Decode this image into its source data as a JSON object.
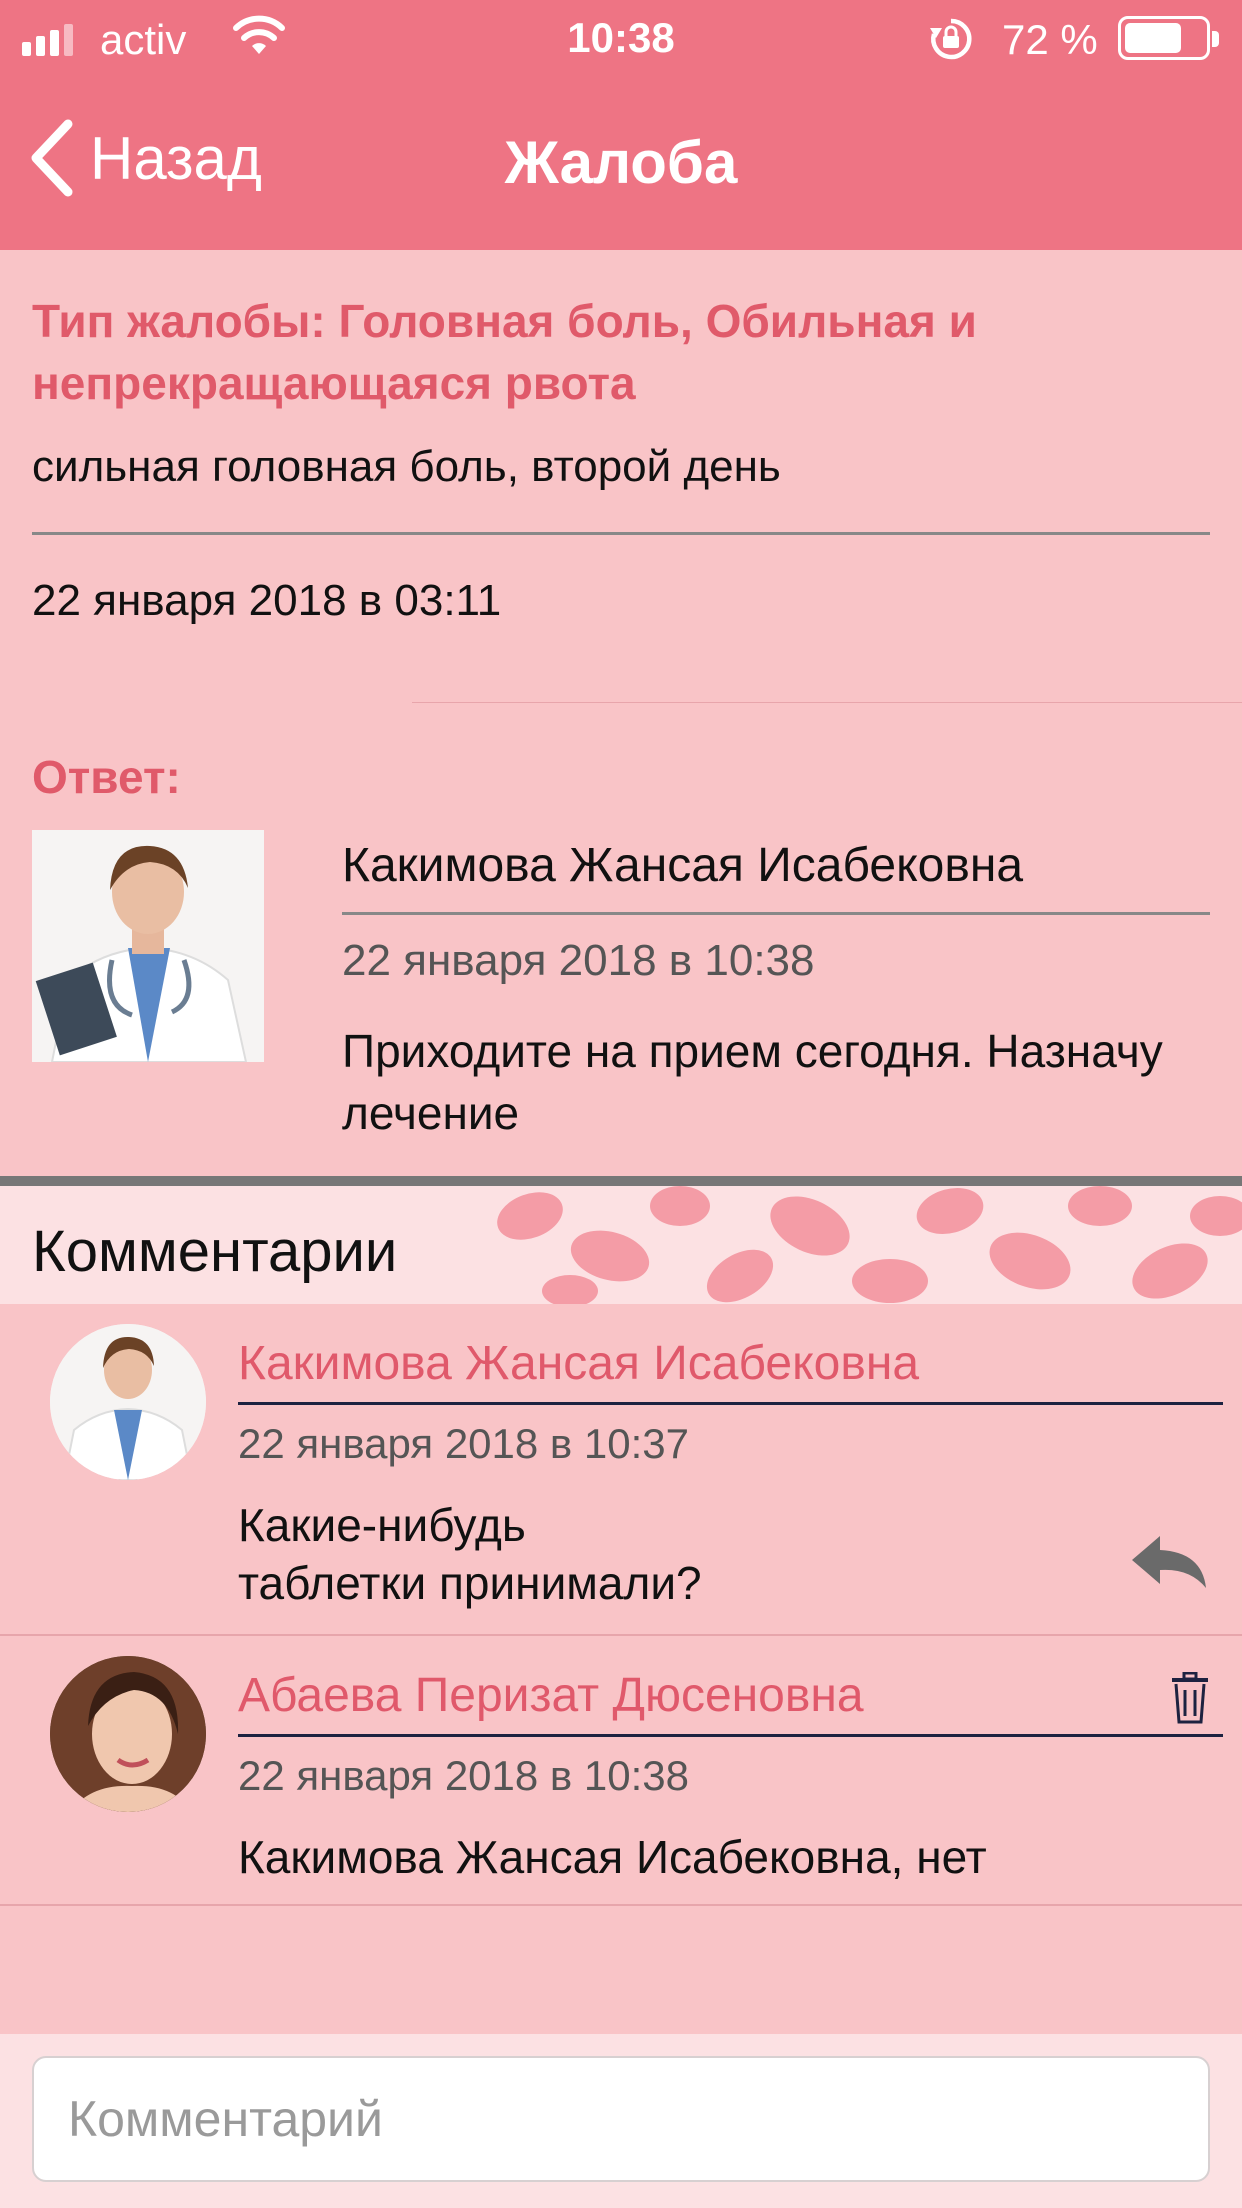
{
  "status_bar": {
    "carrier": "activ",
    "time": "10:38",
    "battery_percent": "72 %",
    "battery_level": 0.72
  },
  "nav": {
    "back_label": "Назад",
    "title": "Жалоба"
  },
  "complaint": {
    "type_text": "Тип жалобы: Головная боль, Обильная и непрекращающаяся рвота",
    "description": "сильная головная боль, второй день",
    "date": "22 января 2018 в 03:11"
  },
  "answer": {
    "label": "Ответ:",
    "author": "Какимова Жансая Исабековна",
    "date": "22 января 2018 в 10:38",
    "text": "Приходите на прием сегодня. Назначу лечение"
  },
  "comments": {
    "title": "Комментарии",
    "items": [
      {
        "author": "Какимова Жансая Исабековна",
        "date": "22 января 2018 в 10:37",
        "text": "Какие-нибудь\nтаблетки принимали?"
      },
      {
        "author": "Абаева Перизат Дюсеновна",
        "date": "22 января 2018 в 10:38",
        "text": "Какимова Жансая Исабековна, нет"
      }
    ]
  },
  "input": {
    "placeholder": "Комментарий",
    "value": ""
  },
  "colors": {
    "header": "#ee7484",
    "accent_text": "#e05a6a",
    "background": "#f9c4c7"
  }
}
